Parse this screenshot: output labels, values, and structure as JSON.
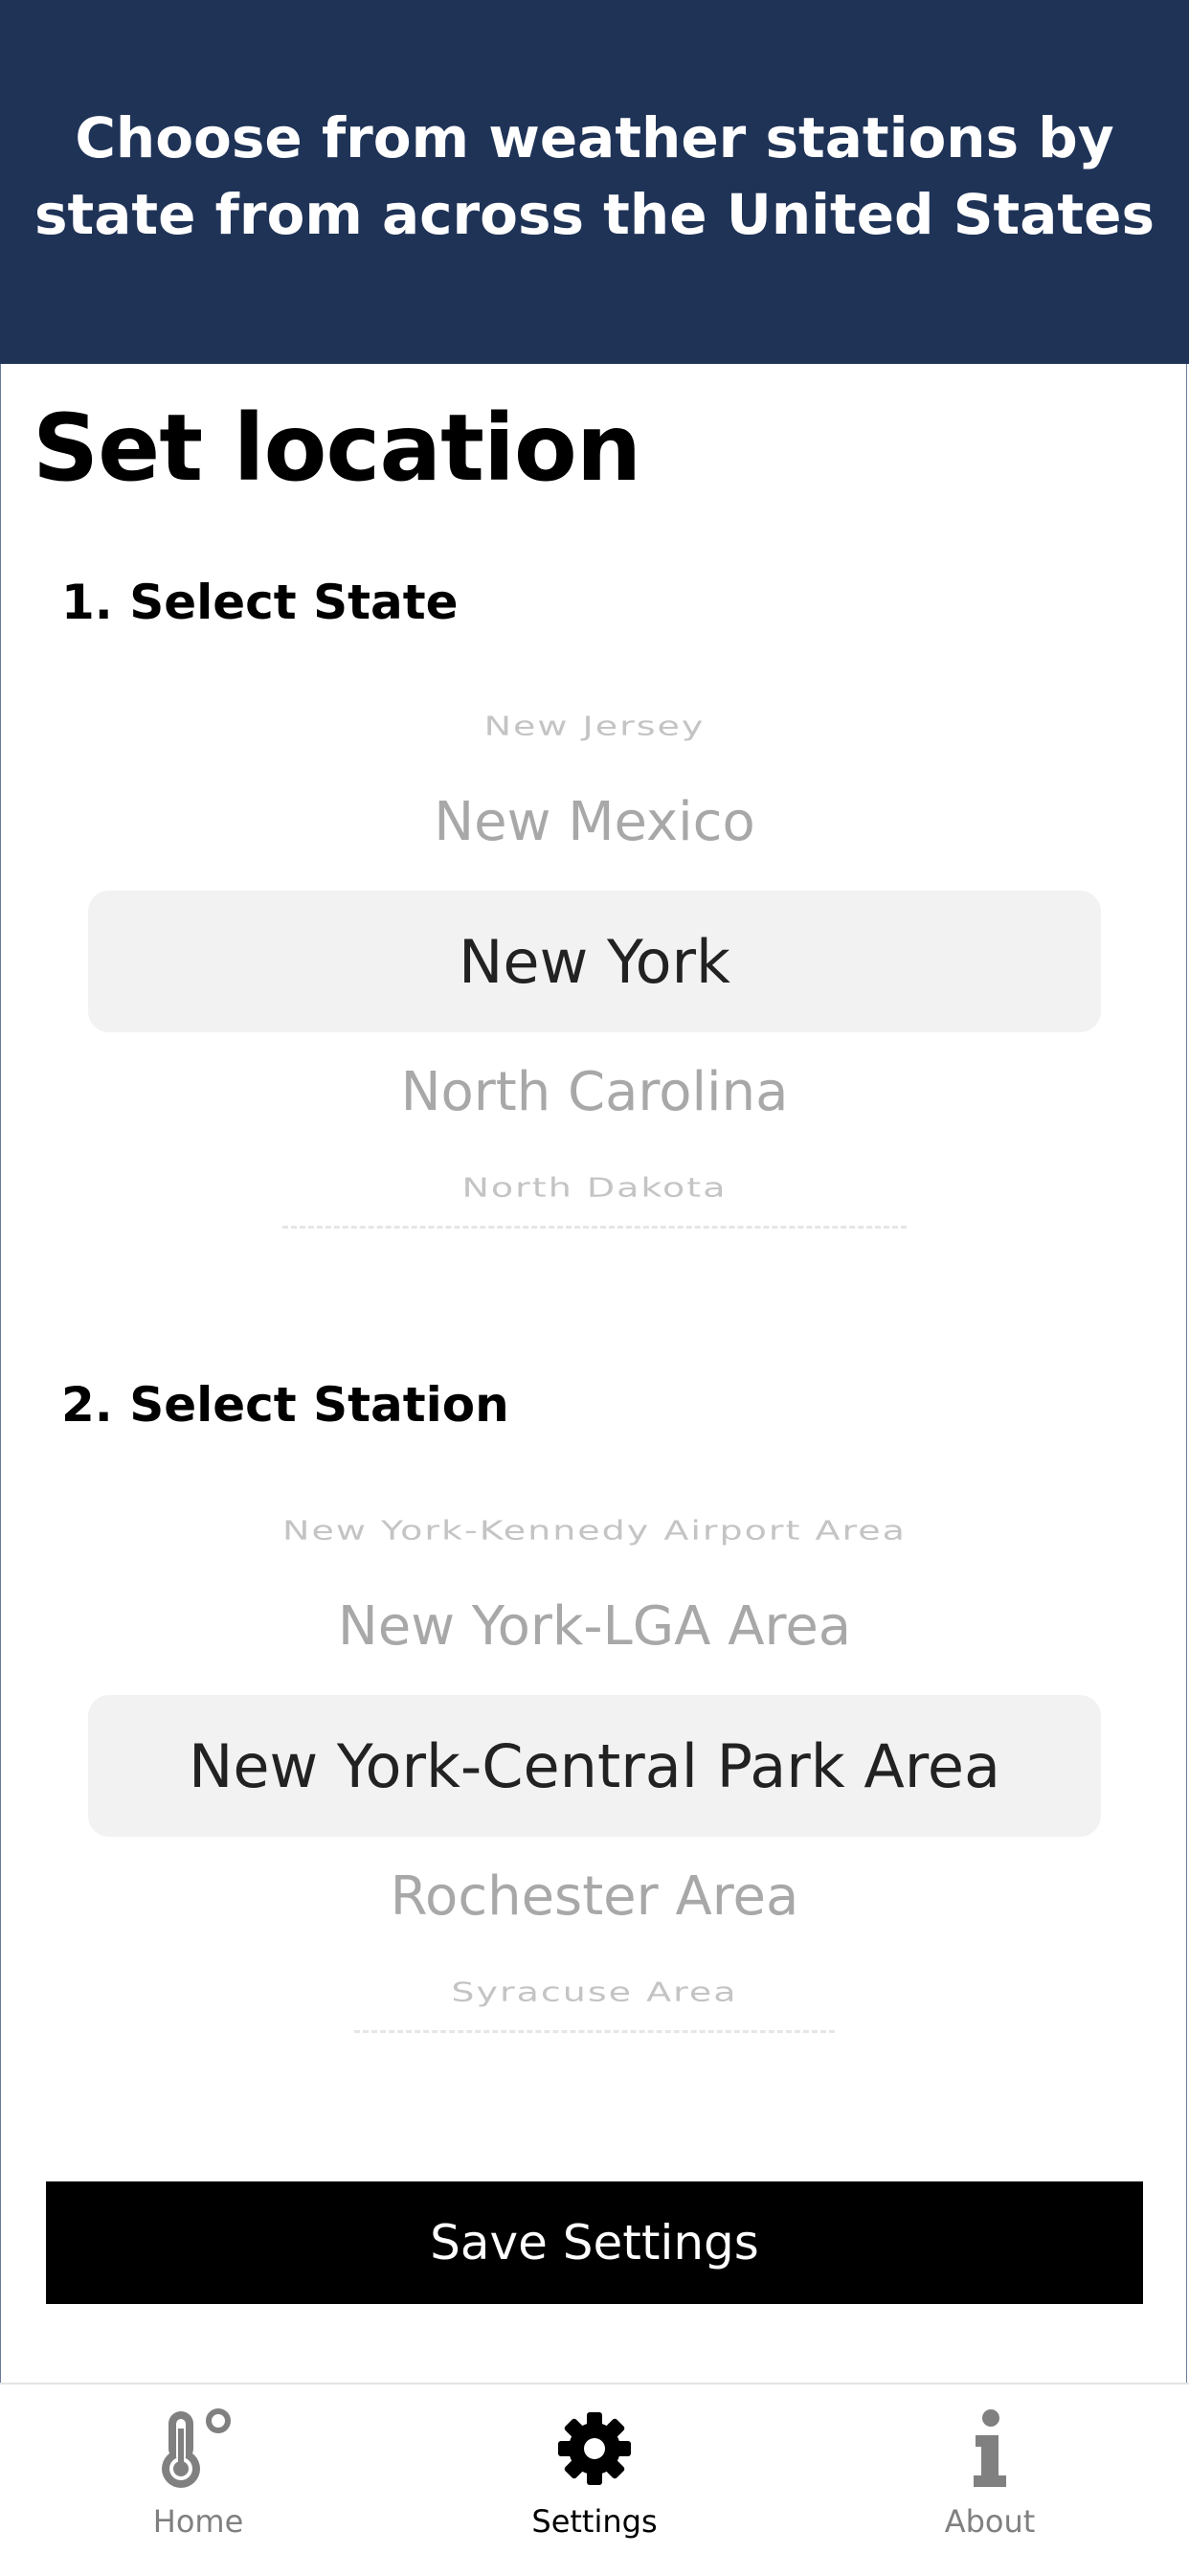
{
  "banner": {
    "line1": "Choose from weather stations by",
    "line2": "state from across the United States"
  },
  "page": {
    "title": "Set location"
  },
  "state_picker": {
    "label": "1. Select State",
    "items": [
      "New Jersey",
      "New Mexico",
      "New York",
      "North Carolina",
      "North Dakota"
    ],
    "selected": "New York"
  },
  "station_picker": {
    "label": "2. Select Station",
    "items": [
      "New York-Kennedy Airport Area",
      "New York-LGA Area",
      "New York-Central Park Area",
      "Rochester Area",
      "Syracuse Area"
    ],
    "selected": "New York-Central Park Area"
  },
  "save_button": {
    "label": "Save Settings"
  },
  "tabbar": {
    "tabs": [
      {
        "label": "Home",
        "icon": "thermometer-degree-icon",
        "active": false
      },
      {
        "label": "Settings",
        "icon": "gear-icon",
        "active": true
      },
      {
        "label": "About",
        "icon": "info-icon",
        "active": false
      }
    ]
  },
  "colors": {
    "banner_bg": "#1f3357",
    "tab_active": "#000000",
    "tab_inactive": "#808080",
    "picker_highlight": "#f2f2f2"
  }
}
